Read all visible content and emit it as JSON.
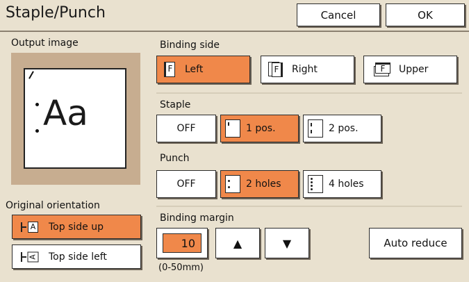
{
  "header": {
    "title": "Staple/Punch",
    "cancel_label": "Cancel",
    "ok_label": "OK"
  },
  "output_image": {
    "label": "Output image",
    "preview_text": "Aa"
  },
  "orientation": {
    "label": "Original orientation",
    "options": [
      {
        "label": "Top side up",
        "selected": true
      },
      {
        "label": "Top side left",
        "selected": false
      }
    ]
  },
  "binding_side": {
    "label": "Binding side",
    "options": [
      {
        "label": "Left",
        "icon_letter": "F",
        "selected": true
      },
      {
        "label": "Right",
        "icon_letter": "F",
        "selected": false
      },
      {
        "label": "Upper",
        "icon_letter": "F",
        "selected": false
      }
    ]
  },
  "staple": {
    "label": "Staple",
    "options": [
      {
        "label": "OFF",
        "selected": false
      },
      {
        "label": "1 pos.",
        "selected": true
      },
      {
        "label": "2 pos.",
        "selected": false
      }
    ]
  },
  "punch": {
    "label": "Punch",
    "options": [
      {
        "label": "OFF",
        "selected": false
      },
      {
        "label": "2 holes",
        "selected": true
      },
      {
        "label": "4 holes",
        "selected": false
      }
    ]
  },
  "binding_margin": {
    "label": "Binding margin",
    "value": "10",
    "range": "(0-50mm)",
    "up_glyph": "▲",
    "down_glyph": "▼",
    "auto_reduce_label": "Auto reduce"
  },
  "colors": {
    "selected": "#f0884a",
    "background": "#e9e1cf",
    "preview_frame": "#c7ad90"
  }
}
